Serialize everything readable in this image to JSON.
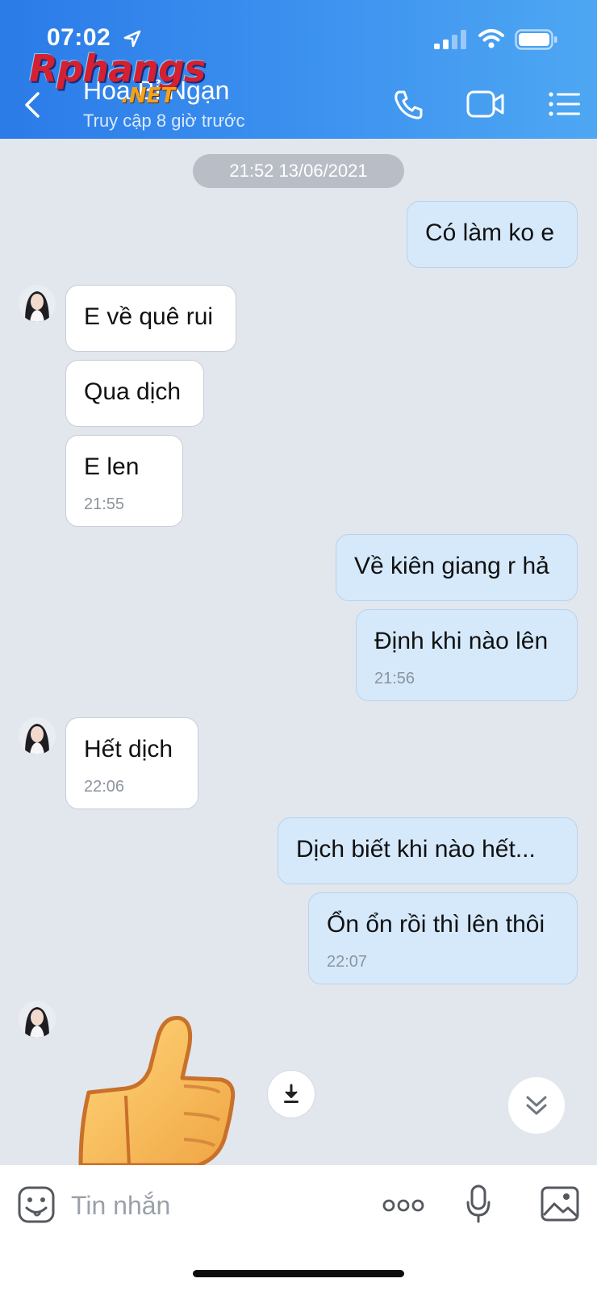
{
  "status_bar": {
    "time": "07:02"
  },
  "header": {
    "contact_name": "Hoa Bỉ Ngạn",
    "contact_status": "Truy cập 8 giờ trước"
  },
  "watermark": {
    "main": "Rphangs",
    "sub": ".NET"
  },
  "chat": {
    "date_separator": "21:52 13/06/2021",
    "messages": [
      {
        "dir": "out",
        "text": "Có làm ko e",
        "time": ""
      },
      {
        "dir": "in",
        "text": "E về quê rui",
        "time": ""
      },
      {
        "dir": "in",
        "text": "Qua dịch",
        "time": ""
      },
      {
        "dir": "in",
        "text": "E len",
        "time": "21:55"
      },
      {
        "dir": "out",
        "text": "Về kiên giang r hả",
        "time": ""
      },
      {
        "dir": "out",
        "text": "Định khi nào lên",
        "time": "21:56"
      },
      {
        "dir": "in",
        "text": "Hết dịch",
        "time": "22:06"
      },
      {
        "dir": "out",
        "text": "Dịch biết khi nào hết...",
        "time": ""
      },
      {
        "dir": "out",
        "text": "Ổn ổn rồi thì lên thôi",
        "time": "22:07"
      }
    ],
    "sticker": "thumbs-up"
  },
  "input_bar": {
    "placeholder": "Tin nhắn"
  },
  "colors": {
    "header_start": "#2b7be8",
    "header_end": "#4ea7f2",
    "chat_bg": "#e2e7ee",
    "outgoing_bubble": "#d5e9fb",
    "incoming_bubble": "#ffffff"
  }
}
